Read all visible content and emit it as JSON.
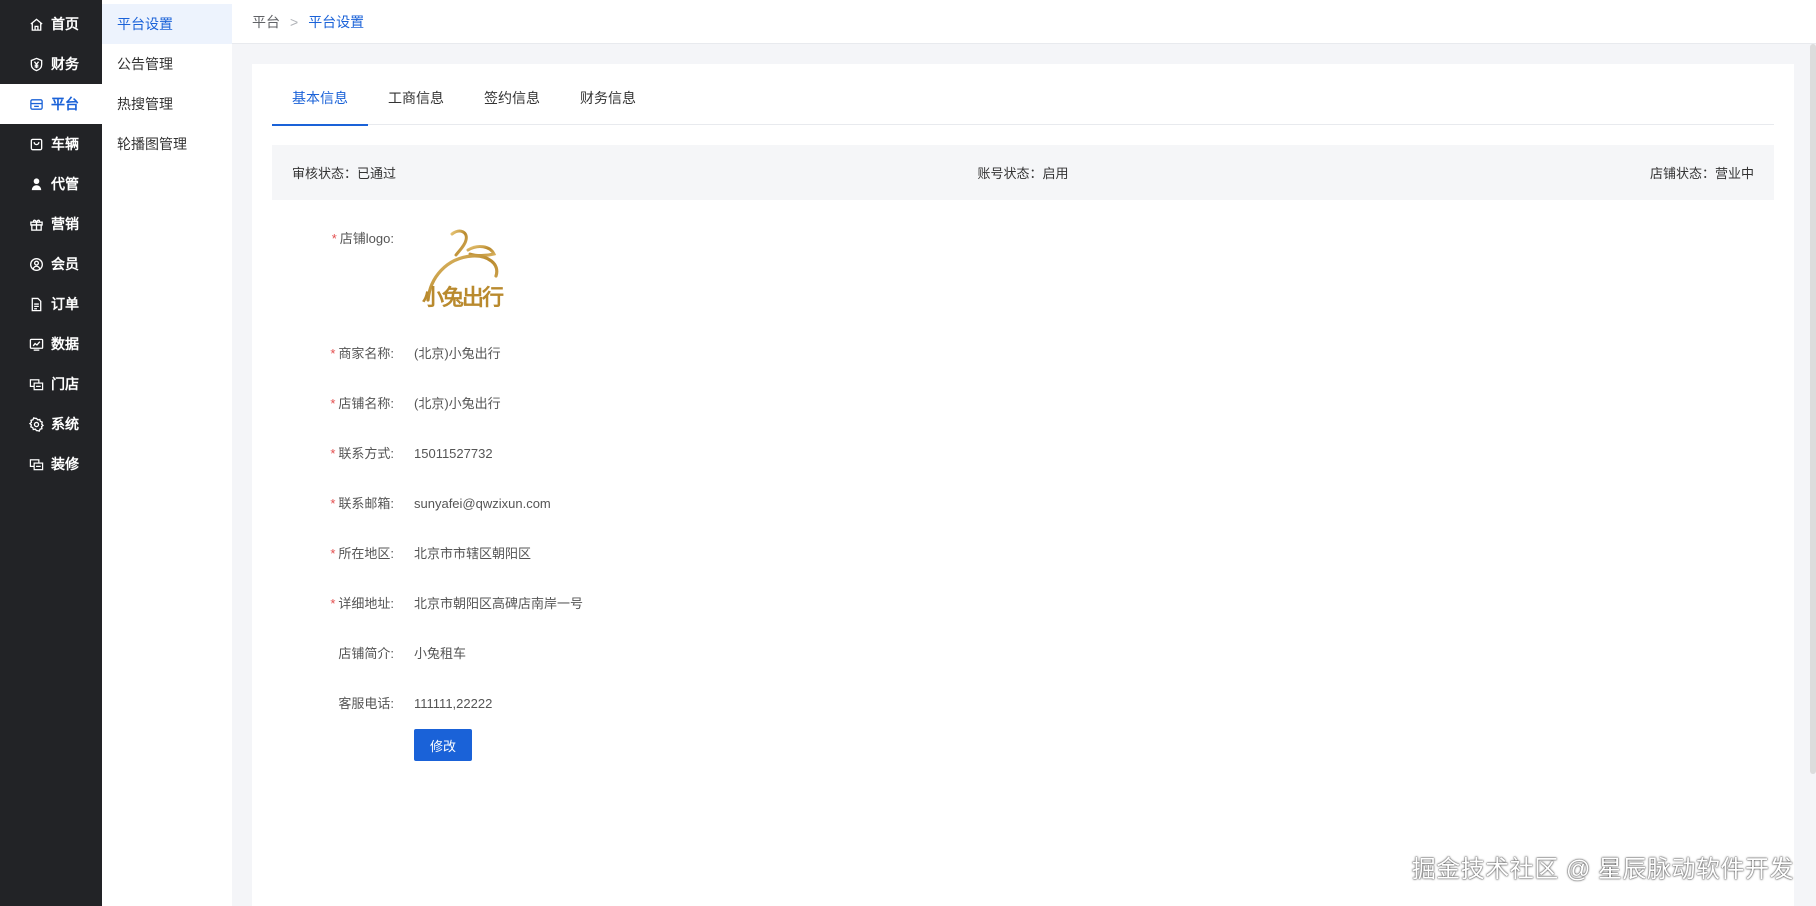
{
  "sidebar": {
    "items": [
      {
        "label": "首页",
        "icon": "home-icon"
      },
      {
        "label": "财务",
        "icon": "yuan-icon"
      },
      {
        "label": "平台",
        "icon": "store-icon"
      },
      {
        "label": "车辆",
        "icon": "car-icon"
      },
      {
        "label": "代管",
        "icon": "agent-icon"
      },
      {
        "label": "营销",
        "icon": "gift-icon"
      },
      {
        "label": "会员",
        "icon": "member-icon"
      },
      {
        "label": "订单",
        "icon": "order-icon"
      },
      {
        "label": "数据",
        "icon": "chart-icon"
      },
      {
        "label": "门店",
        "icon": "shop-icon"
      },
      {
        "label": "系统",
        "icon": "gear-icon"
      },
      {
        "label": "装修",
        "icon": "decor-icon"
      }
    ],
    "active_index": 2
  },
  "subnav": {
    "items": [
      "平台设置",
      "公告管理",
      "热搜管理",
      "轮播图管理"
    ],
    "active_index": 0
  },
  "breadcrumb": {
    "root": "平台",
    "separator": ">",
    "current": "平台设置"
  },
  "tabs": [
    "基本信息",
    "工商信息",
    "签约信息",
    "财务信息"
  ],
  "status": {
    "audit": "审核状态：已通过",
    "account": "账号状态：启用",
    "store": "店铺状态：营业中"
  },
  "form": {
    "logo_label": "店铺logo:",
    "logo_text": "小兔出行",
    "fields": [
      {
        "label": "商家名称:",
        "value": "(北京)小兔出行",
        "required": "*"
      },
      {
        "label": "店铺名称:",
        "value": "(北京)小兔出行",
        "required": "*"
      },
      {
        "label": "联系方式:",
        "value": "15011527732",
        "required": "*"
      },
      {
        "label": "联系邮箱:",
        "value": "sunyafei@qwzixun.com",
        "required": "*"
      },
      {
        "label": "所在地区:",
        "value": "北京市市辖区朝阳区",
        "required": "*"
      },
      {
        "label": "详细地址:",
        "value": "北京市朝阳区高碑店南岸一号",
        "required": "*"
      },
      {
        "label": "店铺简介:",
        "value": "小兔租车",
        "required": ""
      },
      {
        "label": "客服电话:",
        "value": "111111,22222",
        "required": ""
      }
    ],
    "edit_button": "修改"
  },
  "watermark": "掘金技术社区 @ 星辰脉动软件开发",
  "colors": {
    "accent": "#1a62d8",
    "sidebar_bg": "#222326",
    "required": "#e34d4d"
  }
}
